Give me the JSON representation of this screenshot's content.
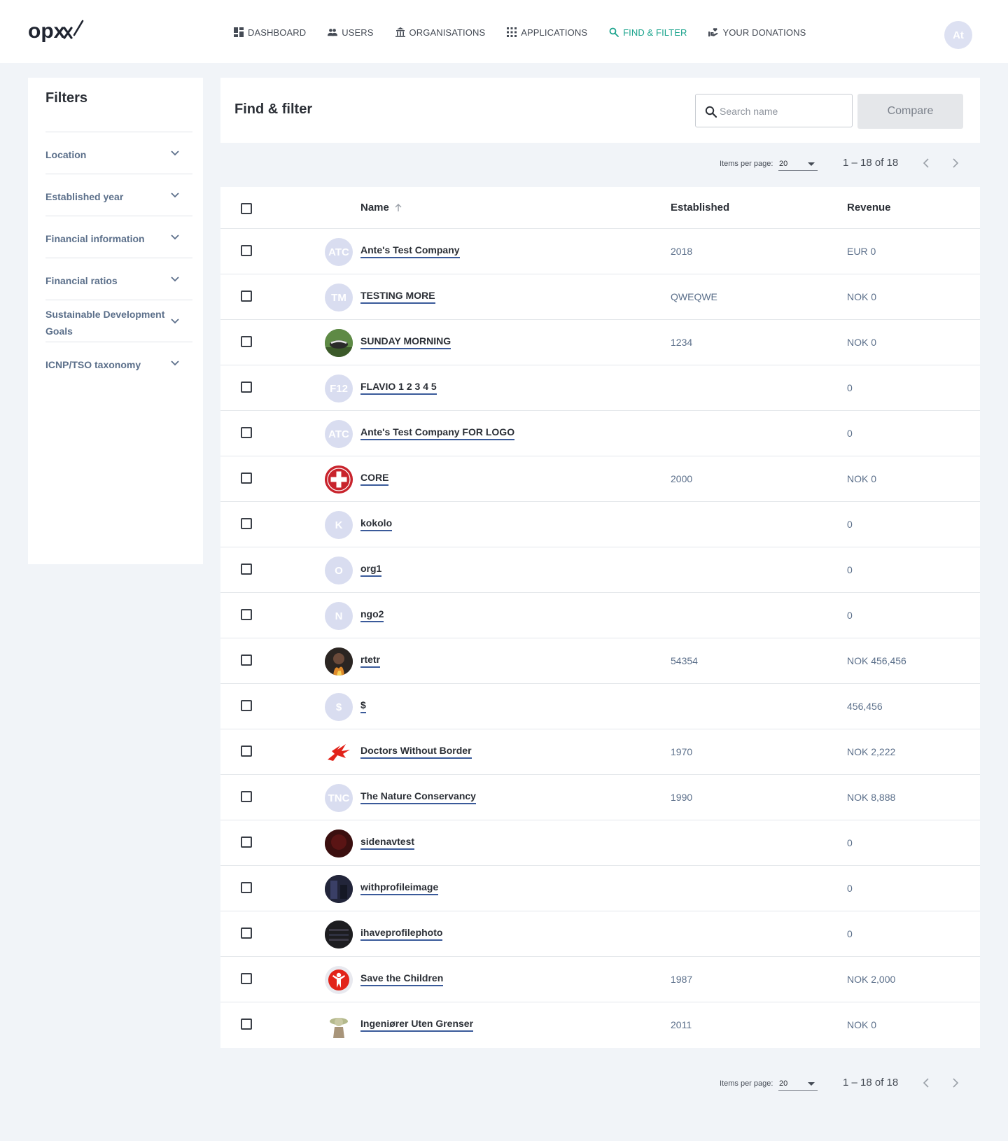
{
  "nav": {
    "logo_text": "opx",
    "items": [
      {
        "label": "DASHBOARD",
        "icon": "dashboard-icon"
      },
      {
        "label": "USERS",
        "icon": "users-icon"
      },
      {
        "label": "ORGANISATIONS",
        "icon": "organisations-icon"
      },
      {
        "label": "APPLICATIONS",
        "icon": "applications-icon"
      },
      {
        "label": "FIND & FILTER",
        "icon": "search-icon",
        "active": true
      },
      {
        "label": "YOUR DONATIONS",
        "icon": "donations-icon"
      }
    ],
    "avatar_initials": "At"
  },
  "filters": {
    "title": "Filters",
    "items": [
      {
        "label": "Location"
      },
      {
        "label": "Established year"
      },
      {
        "label": "Financial information"
      },
      {
        "label": "Financial ratios"
      },
      {
        "label": "Sustainable Development Goals"
      },
      {
        "label": "ICNP/TSO taxonomy"
      }
    ]
  },
  "main": {
    "title": "Find & filter",
    "search_placeholder": "Search name",
    "compare_label": "Compare"
  },
  "paginator": {
    "items_per_page_label": "Items per page:",
    "items_per_page": "20",
    "range": "1 – 18 of 18"
  },
  "table": {
    "columns": {
      "name": "Name",
      "established": "Established",
      "revenue": "Revenue"
    },
    "sort": "ascending",
    "rows": [
      {
        "name": "Ante's Test Company",
        "initials": "ATC",
        "established": "2018",
        "revenue": "EUR 0",
        "logo": "initials"
      },
      {
        "name": "TESTING MORE",
        "initials": "TM",
        "established": "QWEQWE",
        "revenue": "NOK 0",
        "logo": "initials"
      },
      {
        "name": "SUNDAY MORNING",
        "initials": "",
        "established": "1234",
        "revenue": "NOK 0",
        "logo": "photo-badger"
      },
      {
        "name": "FLAVIO 1 2 3 4 5",
        "initials": "F12",
        "established": "",
        "revenue": "0",
        "logo": "initials"
      },
      {
        "name": "Ante's Test Company FOR LOGO",
        "initials": "ATC",
        "established": "",
        "revenue": "0",
        "logo": "initials"
      },
      {
        "name": "CORE",
        "initials": "",
        "established": "2000",
        "revenue": "NOK 0",
        "logo": "red-cross"
      },
      {
        "name": "kokolo",
        "initials": "K",
        "established": "",
        "revenue": "0",
        "logo": "initials"
      },
      {
        "name": "org1",
        "initials": "O",
        "established": "",
        "revenue": "0",
        "logo": "initials"
      },
      {
        "name": "ngo2",
        "initials": "N",
        "established": "",
        "revenue": "0",
        "logo": "initials"
      },
      {
        "name": "rtetr",
        "initials": "",
        "established": "54354",
        "revenue": "NOK 456,456",
        "logo": "photo-fire"
      },
      {
        "name": "$",
        "initials": "$",
        "established": "",
        "revenue": "456,456",
        "logo": "initials"
      },
      {
        "name": "Doctors Without Border",
        "initials": "",
        "established": "1970",
        "revenue": "NOK 2,222",
        "logo": "msf"
      },
      {
        "name": "The Nature Conservancy",
        "initials": "TNC",
        "established": "1990",
        "revenue": "NOK 8,888",
        "logo": "initials"
      },
      {
        "name": "sidenavtest",
        "initials": "",
        "established": "",
        "revenue": "0",
        "logo": "photo-dark-red"
      },
      {
        "name": "withprofileimage",
        "initials": "",
        "established": "",
        "revenue": "0",
        "logo": "photo-dark-blue"
      },
      {
        "name": "ihaveprofilephoto",
        "initials": "",
        "established": "",
        "revenue": "0",
        "logo": "photo-dark"
      },
      {
        "name": "Save the Children",
        "initials": "",
        "established": "1987",
        "revenue": "NOK 2,000",
        "logo": "save-children"
      },
      {
        "name": "Ingeniører Uten Grenser",
        "initials": "",
        "established": "2011",
        "revenue": "NOK 0",
        "logo": "photo-figure"
      }
    ]
  }
}
